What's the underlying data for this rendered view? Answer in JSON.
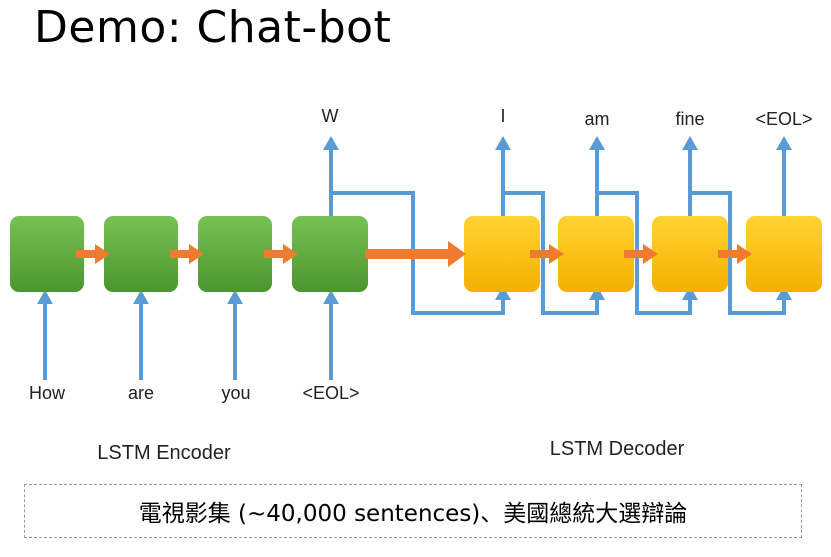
{
  "title": "Demo: Chat-bot",
  "encoder": {
    "label": "LSTM Encoder",
    "inputs": [
      "How",
      "are",
      "you",
      "<EOL>"
    ]
  },
  "decoder": {
    "label": "LSTM Decoder",
    "outputs": [
      "W",
      "I",
      "am",
      "fine",
      "<EOL>"
    ]
  },
  "caption": "電視影集 (~40,000 sentences)、美國總統大選辯論",
  "colors": {
    "encoder_green": "#5aa83a",
    "decoder_yellow": "#fbbf14",
    "arrow_orange": "#ee7b30",
    "line_blue": "#5b9bd5"
  }
}
